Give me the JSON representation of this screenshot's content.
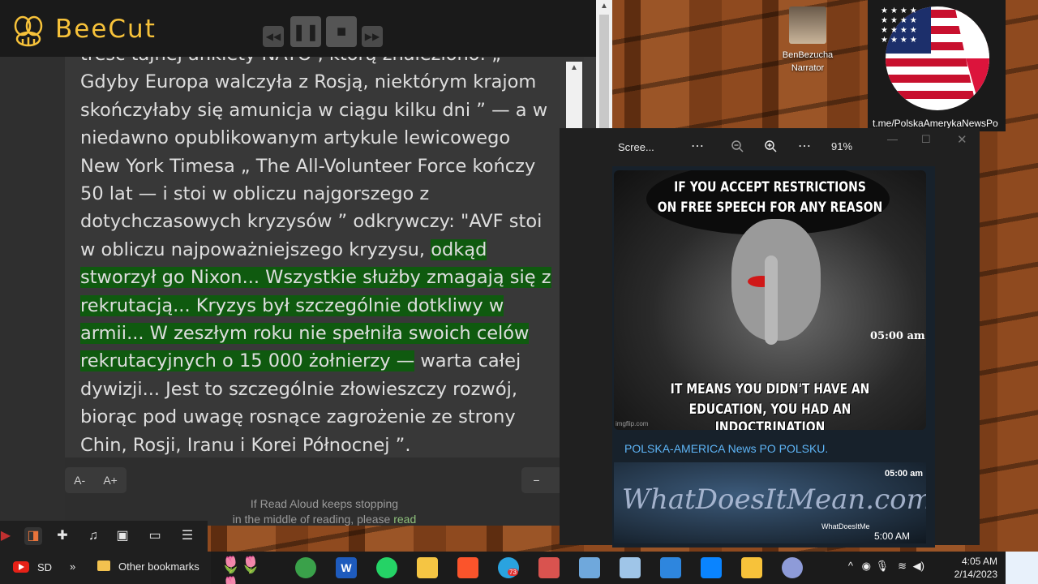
{
  "app": {
    "name": "BeeCut"
  },
  "reader": {
    "lines": [
      {
        "pre": "treść tajnej ankiety NATO , którą znaleziono: „",
        "hl": "",
        "post": ""
      },
      {
        "pre": "Gdyby Europa walczyła z Rosją, niektórym krajom",
        "hl": "",
        "post": ""
      },
      {
        "pre": "skończyłaby się amunicja w ciągu kilku dni ” — a w",
        "hl": "",
        "post": ""
      },
      {
        "pre": "niedawno opublikowanym artykule lewicowego",
        "hl": "",
        "post": ""
      },
      {
        "pre": "New York Timesa „ The All-Volunteer Force kończy",
        "hl": "",
        "post": ""
      },
      {
        "pre": "50 lat — i stoi w obliczu najgorszego z",
        "hl": "",
        "post": ""
      },
      {
        "pre": "dotychczasowych kryzysów ” odkrywczy: \"AVF stoi",
        "hl": "",
        "post": ""
      },
      {
        "pre": "w obliczu najpoważniejszego kryzysu, ",
        "hl": "odkąd",
        "post": ""
      },
      {
        "pre": "",
        "hl": "stworzył go Nixon... Wszystkie służby zmagają się z",
        "post": ""
      },
      {
        "pre": "",
        "hl": "rekrutacją... Kryzys był szczególnie dotkliwy w",
        "post": ""
      },
      {
        "pre": "",
        "hl": "armii... W zeszłym roku nie spełniła swoich celów",
        "post": ""
      },
      {
        "pre": "",
        "hl": "rekrutacyjnych o 15 000 żołnierzy —",
        "post": " warta całej"
      },
      {
        "pre": "dywizji... Jest to szczególnie złowieszczy rozwój,",
        "hl": "",
        "post": ""
      },
      {
        "pre": "biorąc pod uwagę rosnące zagrożenie ze strony",
        "hl": "",
        "post": ""
      },
      {
        "pre": "Chin, Rosji, Iranu i Korei Północnej ”.",
        "hl": "",
        "post": ""
      }
    ],
    "font_smaller": "A-",
    "font_larger": "A+",
    "minus": "−",
    "plus": "+",
    "hint": "If Read Aloud keeps stopping",
    "hint2": "in the middle of reading, please",
    "hint_link": "read"
  },
  "desktop": {
    "icon_label_1": "BenBezucha",
    "icon_label_2": "Narrator",
    "flag_caption": "t.me/PolskaAmerykaNewsPo"
  },
  "viewer": {
    "title": "Scree...",
    "zoom": "91%",
    "meme_top_1": "IF YOU ACCEPT RESTRICTIONS",
    "meme_top_2": "ON FREE SPEECH FOR ANY REASON",
    "meme_time": "05:00 am",
    "meme_bottom_1": "IT MEANS YOU DIDN'T HAVE AN",
    "meme_bottom_2": "EDUCATION, YOU HAD AN INDOCTRINATION",
    "meme_credit": "imgflip.com",
    "channel": "POLSKA-AMERICA News PO POLSKU.",
    "promo_watermark": "WhatDoesItMean.com",
    "promo_time_top": "05:00 am",
    "promo_time_bottom": "5:00 AM",
    "promo_small": "WhatDoesItMe"
  },
  "bookmarks": {
    "sd": "SD",
    "more": "»",
    "other": "Other bookmarks"
  },
  "taskbar": {
    "time": "4:05 AM",
    "date": "2/14/2023",
    "badge": "73"
  }
}
